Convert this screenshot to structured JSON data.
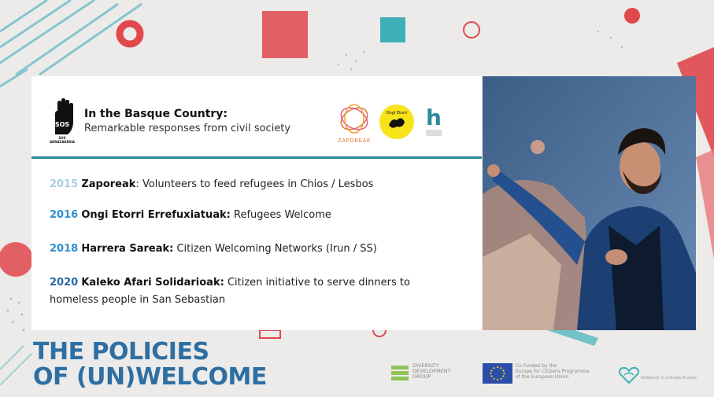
{
  "header": {
    "title": "In the Basque Country:",
    "subtitle": "Remarkable responses from civil society",
    "sos_logo_text": "SOS ARRAZAKERIA",
    "logos": {
      "zaporeak_label": "ZAPOREAK",
      "ongi_label": "Ongi Etorri",
      "harrera_label": "h"
    }
  },
  "entries": [
    {
      "year": "2015",
      "name": "Zaporeak",
      "sep": ": ",
      "text": "Volunteers to feed refugees in Chios / Lesbos"
    },
    {
      "year": "2016",
      "name": "Ongi Etorri Errefuxiatuak:",
      "sep": " ",
      "text": "Refugees Welcome"
    },
    {
      "year": "2018",
      "name": "Harrera Sareak:",
      "sep": " ",
      "text": "Citizen Welcoming Networks (Irun / SS)"
    },
    {
      "year": "2020",
      "name": "Kaleko Afari Solidarioak:",
      "sep": " ",
      "text": "Citizen initiative to serve dinners to homeless people in San Sebastian"
    }
  ],
  "bottom_title": {
    "line1": "THE POLICIES",
    "line2": "OF (UN)WELCOME"
  },
  "footer": {
    "ddg_line1": "DIVERSITY",
    "ddg_line2": "DEVELOPMENT",
    "ddg_line3": "GROUP",
    "eu_line1": "Co-funded by the",
    "eu_line2": "Europe for Citizens Programme",
    "eu_line3": "of the European Union",
    "heart_text": "Solidarity in a Stable Europe"
  },
  "colors": {
    "accent_teal": "#2b8b98",
    "title_blue": "#2e6fa3",
    "deco_red": "#e0484c",
    "deco_teal": "#3fb0b8"
  }
}
